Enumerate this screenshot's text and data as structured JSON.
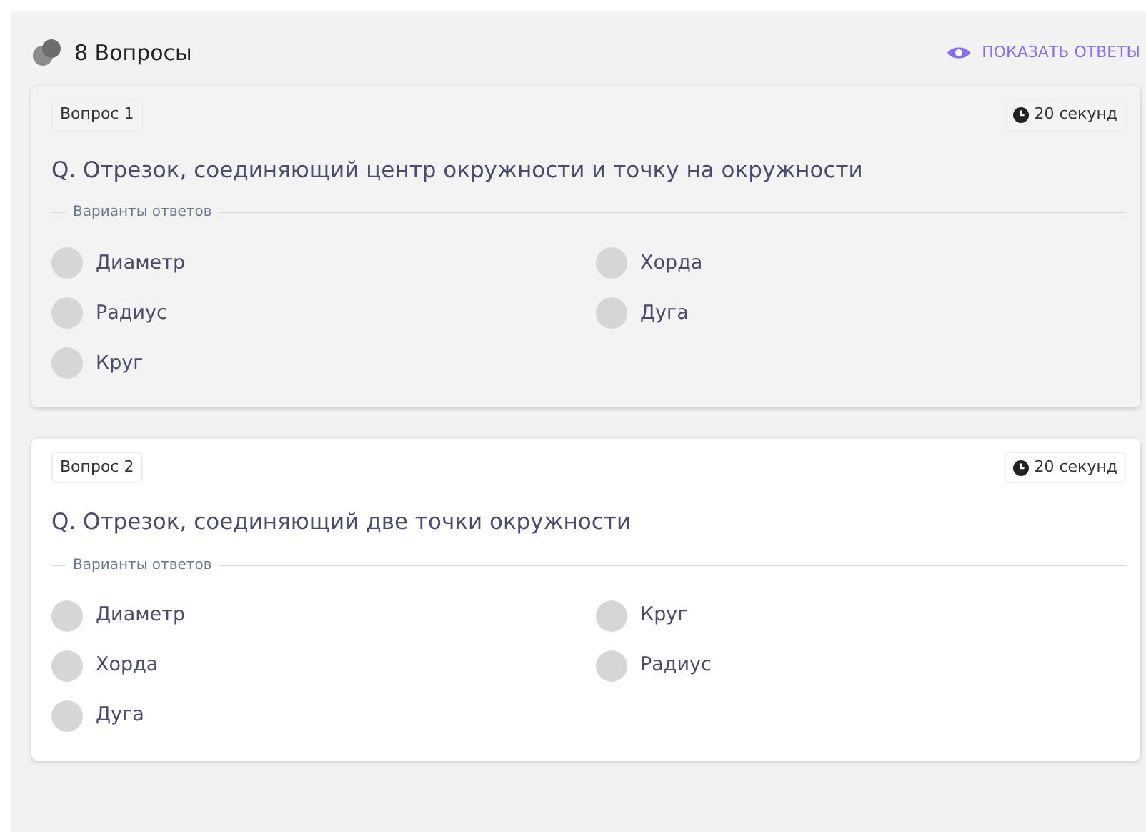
{
  "header": {
    "title": "8 Вопросы",
    "show_answers": "ПОКАЗАТЬ ОТВЕТЫ"
  },
  "questions": [
    {
      "label": "Вопрос 1",
      "time": "20 секунд",
      "highlighted": true,
      "text": "Q. Отрезок, соединяющий центр окружности и точку на окружности",
      "options_legend": "Варианты ответов",
      "options": [
        {
          "text": "Диаметр",
          "selected": false
        },
        {
          "text": "Хорда",
          "selected": false
        },
        {
          "text": "Радиус",
          "selected": false
        },
        {
          "text": "Дуга",
          "selected": false
        },
        {
          "text": "Круг",
          "selected": false
        }
      ]
    },
    {
      "label": "Вопрос 2",
      "time": "20 секунд",
      "highlighted": false,
      "text": "Q. Отрезок, соединяющий две точки окружности",
      "options_legend": "Варианты ответов",
      "options": [
        {
          "text": "Диаметр",
          "selected": false
        },
        {
          "text": "Круг",
          "selected": false
        },
        {
          "text": "Хорда",
          "selected": false
        },
        {
          "text": "Радиус",
          "selected": false
        },
        {
          "text": "Дуга",
          "selected": false
        }
      ]
    }
  ]
}
